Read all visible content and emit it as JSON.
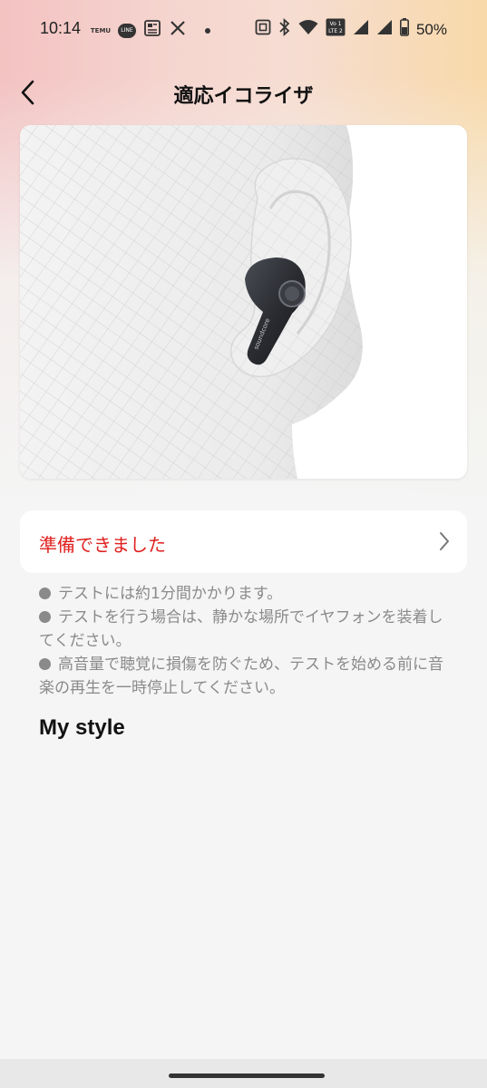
{
  "status_bar": {
    "time": "10:14",
    "temu_label": "TEMU",
    "line_label": "LINE",
    "battery_percent": "50%",
    "vo_lte_label": "Vo LTE"
  },
  "header": {
    "title": "適応イコライザ"
  },
  "ready_card": {
    "label": "準備できました"
  },
  "notes": [
    "テストには約1分間かかります。",
    "テストを行う場合は、静かな場所でイヤフォンを装着してください。",
    "高音量で聴覚に損傷を防ぐため、テストを始める前に音楽の再生を一時停止してください。"
  ],
  "section": {
    "title": "My style"
  },
  "earbud_brand": "soundcore",
  "colors": {
    "accent_red": "#e0211f",
    "note_gray": "#8a8a8a"
  }
}
